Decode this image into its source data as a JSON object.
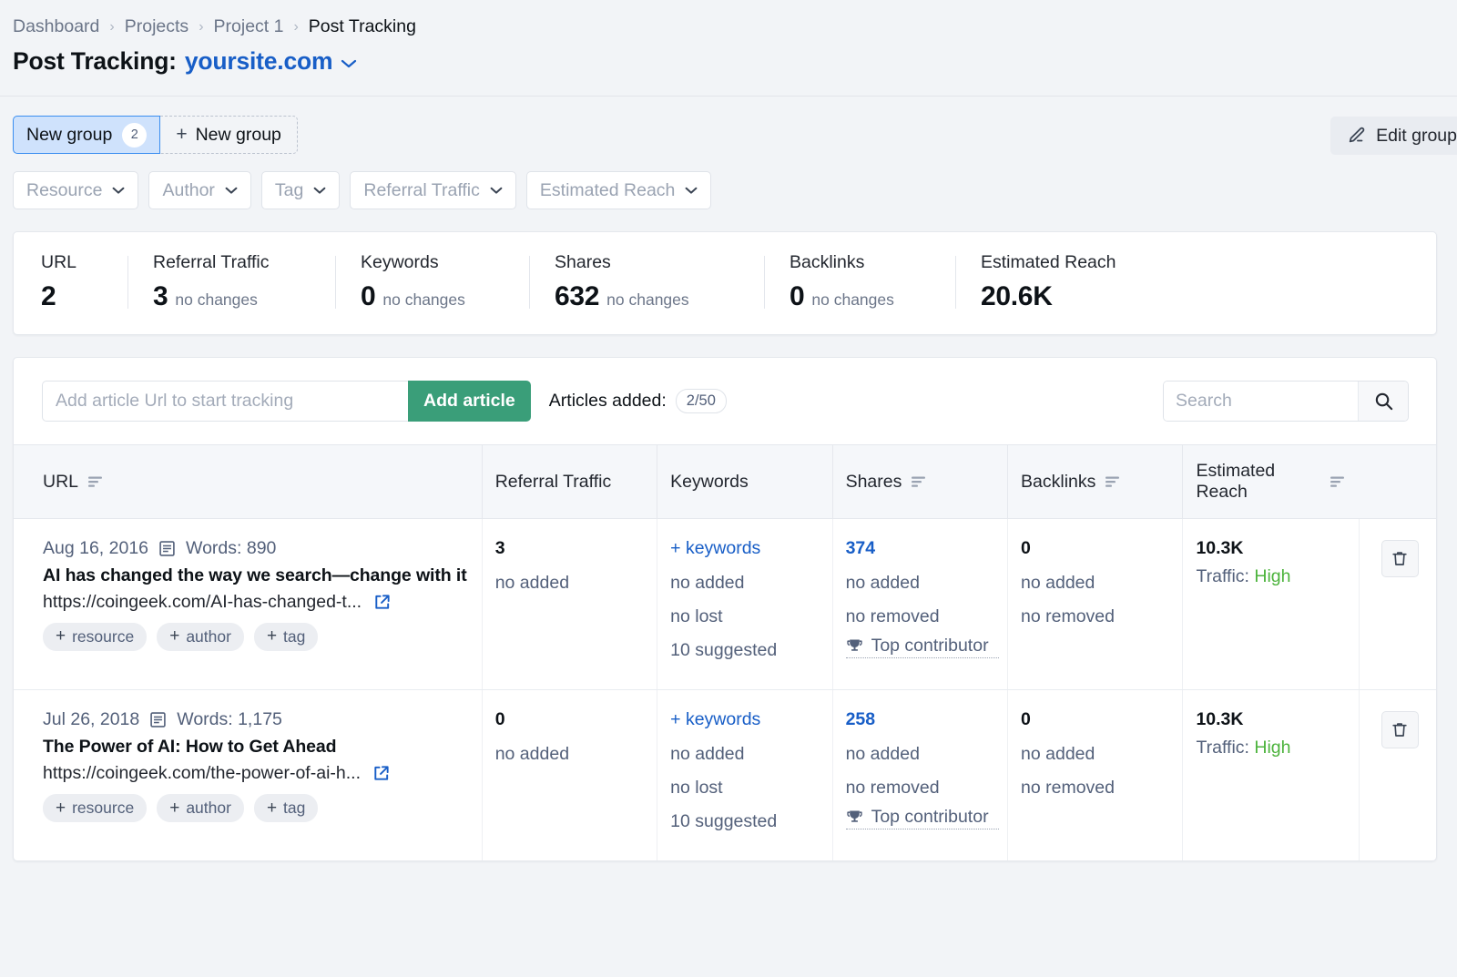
{
  "breadcrumb": {
    "items": [
      "Dashboard",
      "Projects",
      "Project 1",
      "Post Tracking"
    ],
    "separator": "›"
  },
  "page": {
    "title_prefix": "Post Tracking:",
    "site": "yoursite.com",
    "caret": "⌄"
  },
  "groups": {
    "active_label": "New group",
    "active_count": "2",
    "new_label": "New group",
    "new_plus": "+",
    "edit_label": "Edit group",
    "edit_icon": "pencil-icon"
  },
  "filters": [
    {
      "label": "Resource",
      "name": "resource"
    },
    {
      "label": "Author",
      "name": "author"
    },
    {
      "label": "Tag",
      "name": "tag"
    },
    {
      "label": "Referral Traffic",
      "name": "referral-traffic"
    },
    {
      "label": "Estimated Reach",
      "name": "estimated-reach"
    }
  ],
  "stats": [
    {
      "label": "URL",
      "value": "2",
      "change": ""
    },
    {
      "label": "Referral Traffic",
      "value": "3",
      "change": "no changes"
    },
    {
      "label": "Keywords",
      "value": "0",
      "change": "no changes"
    },
    {
      "label": "Shares",
      "value": "632",
      "change": "no changes"
    },
    {
      "label": "Backlinks",
      "value": "0",
      "change": "no changes"
    },
    {
      "label": "Estimated Reach",
      "value": "20.6K",
      "change": ""
    }
  ],
  "toolbar": {
    "url_placeholder": "Add article Url to start tracking",
    "url_value": "",
    "add_label": "Add article",
    "added_label": "Articles added:",
    "added_pill": "2/50",
    "search_placeholder": "Search",
    "search_value": "",
    "search_icon": "search-icon"
  },
  "table": {
    "columns": [
      {
        "label": "URL",
        "sortable": true
      },
      {
        "label": "Referral Traffic",
        "sortable": false
      },
      {
        "label": "Keywords",
        "sortable": false
      },
      {
        "label": "Shares",
        "sortable": true
      },
      {
        "label": "Backlinks",
        "sortable": true
      },
      {
        "label": "Estimated\nReach",
        "sortable": true
      }
    ],
    "rows": [
      {
        "date": "Aug 16, 2016",
        "words": "Words: 890",
        "title": "AI has changed the way we search—change with it",
        "url": "https://coingeek.com/AI-has-changed-t...",
        "chips": [
          "resource",
          "author",
          "tag"
        ],
        "referral_traffic": {
          "value": "3",
          "sub": [
            "no added"
          ]
        },
        "keywords": {
          "link": "+ keywords",
          "sub": [
            "no added",
            "no lost",
            "10 suggested"
          ]
        },
        "shares": {
          "value": "374",
          "sub": [
            "no added",
            "no removed"
          ],
          "contributor": "Top contributor"
        },
        "backlinks": {
          "value": "0",
          "sub": [
            "no added",
            "no removed"
          ]
        },
        "reach": {
          "value": "10.3K",
          "traffic_label": "Traffic:",
          "traffic_value": "High"
        },
        "delete_icon": "trash-icon"
      },
      {
        "date": "Jul 26, 2018",
        "words": "Words: 1,175",
        "title": "The Power of AI: How to Get Ahead",
        "url": "https://coingeek.com/the-power-of-ai-h...",
        "chips": [
          "resource",
          "author",
          "tag"
        ],
        "referral_traffic": {
          "value": "0",
          "sub": [
            "no added"
          ]
        },
        "keywords": {
          "link": "+ keywords",
          "sub": [
            "no added",
            "no lost",
            "10 suggested"
          ]
        },
        "shares": {
          "value": "258",
          "sub": [
            "no added",
            "no removed"
          ],
          "contributor": "Top contributor"
        },
        "backlinks": {
          "value": "0",
          "sub": [
            "no added",
            "no removed"
          ]
        },
        "reach": {
          "value": "10.3K",
          "traffic_label": "Traffic:",
          "traffic_value": "High"
        },
        "delete_icon": "trash-icon"
      }
    ]
  },
  "colors": {
    "accent_blue": "#185ec7",
    "green_button": "#3a9e79",
    "traffic_high": "#4cb33c",
    "tab_active_bg": "#cfe2fc",
    "page_bg": "#f2f4f7"
  }
}
